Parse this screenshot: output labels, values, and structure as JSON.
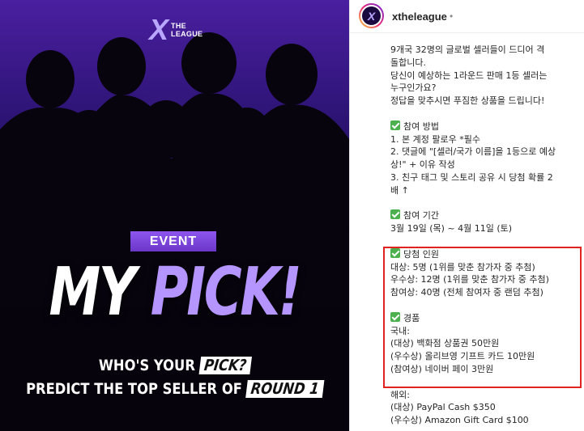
{
  "poster": {
    "logo_mark": "X",
    "logo_text": "THE LEAGUE",
    "event_label": "EVENT",
    "headline_main": "MY ",
    "headline_accent": "PICK!",
    "tagline_1_before": "WHO'S YOUR ",
    "tagline_1_pill": "PICK?",
    "tagline_2_before": "PREDICT THE TOP SELLER OF ",
    "tagline_2_pill": "ROUND 1",
    "colors": {
      "accent_purple": "#b595ff",
      "badge_purple": "#7b45db"
    }
  },
  "post": {
    "username": "xtheleague",
    "dot": "•",
    "avatar_mark": "X",
    "intro": [
      "9개국 32명의 글로벌 셀러들이 드디어 격",
      "돌합니다.",
      "당신이 예상하는 1라운드 판매 1등 셀러는",
      "누구인가요?",
      "정답을 맞추시면 푸짐한 상품을 드립니다!"
    ],
    "how_title": "참여 방법",
    "how_items": [
      "1. 본 계정 팔로우 *필수",
      "2. 댓글에 \"[셀러/국가 이름]을 1등으로 예상",
      "상!\" + 이유 작성",
      "3. 친구 태그 및 스토리 공유 시 당첨 확률 2",
      "배 ↑"
    ],
    "period_title": "참여 기간",
    "period_value": "3월 19일 (목) ~ 4월 11일 (토)",
    "winners_title": "당첨 인원",
    "winners_items": [
      "대상: 5명 (1위를 맞춘 참가자 중 추첨)",
      "우수상: 12명 (1위를 맞춘 참가자 중 추첨)",
      "참여상: 40명 (전체 참여자 중 랜덤 추첨)"
    ],
    "prizes_title": "경품",
    "domestic_label": "국내:",
    "domestic_items": [
      "(대상) 백화점 상품권 50만원",
      "(우수상) 올리브영 기프트 카드 10만원",
      "(참여상) 네이버 페이 3만원"
    ],
    "overseas_label": "해외:",
    "overseas_items": [
      "(대상) PayPal Cash $350",
      "(우수상) Amazon Gift Card $100"
    ],
    "colors": {
      "check_green": "#4cb04f",
      "highlight_red": "#e0231e"
    }
  }
}
